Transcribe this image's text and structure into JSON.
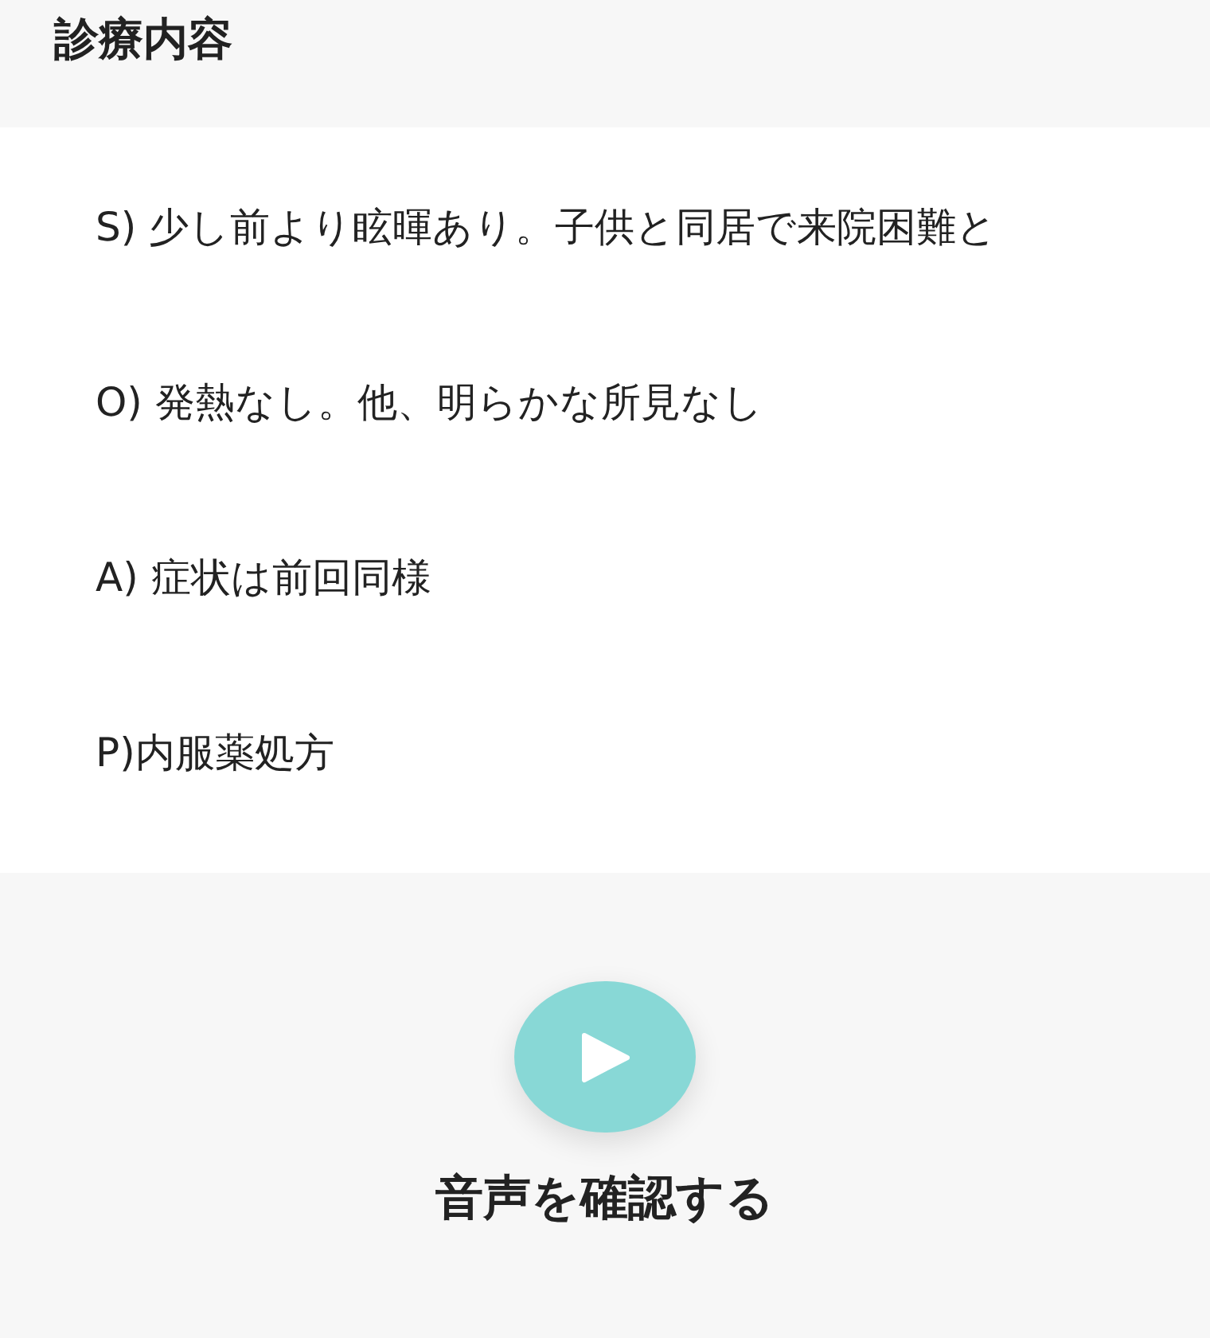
{
  "section_title": "診療内容",
  "notes": [
    "S) 少し前より眩暉あり。子供と同居で来院困難と",
    "O) 発熱なし。他、明らかな所見なし",
    "A) 症状は前回同様",
    "P)内服薬処方"
  ],
  "audio": {
    "label": "音声を確認する"
  }
}
